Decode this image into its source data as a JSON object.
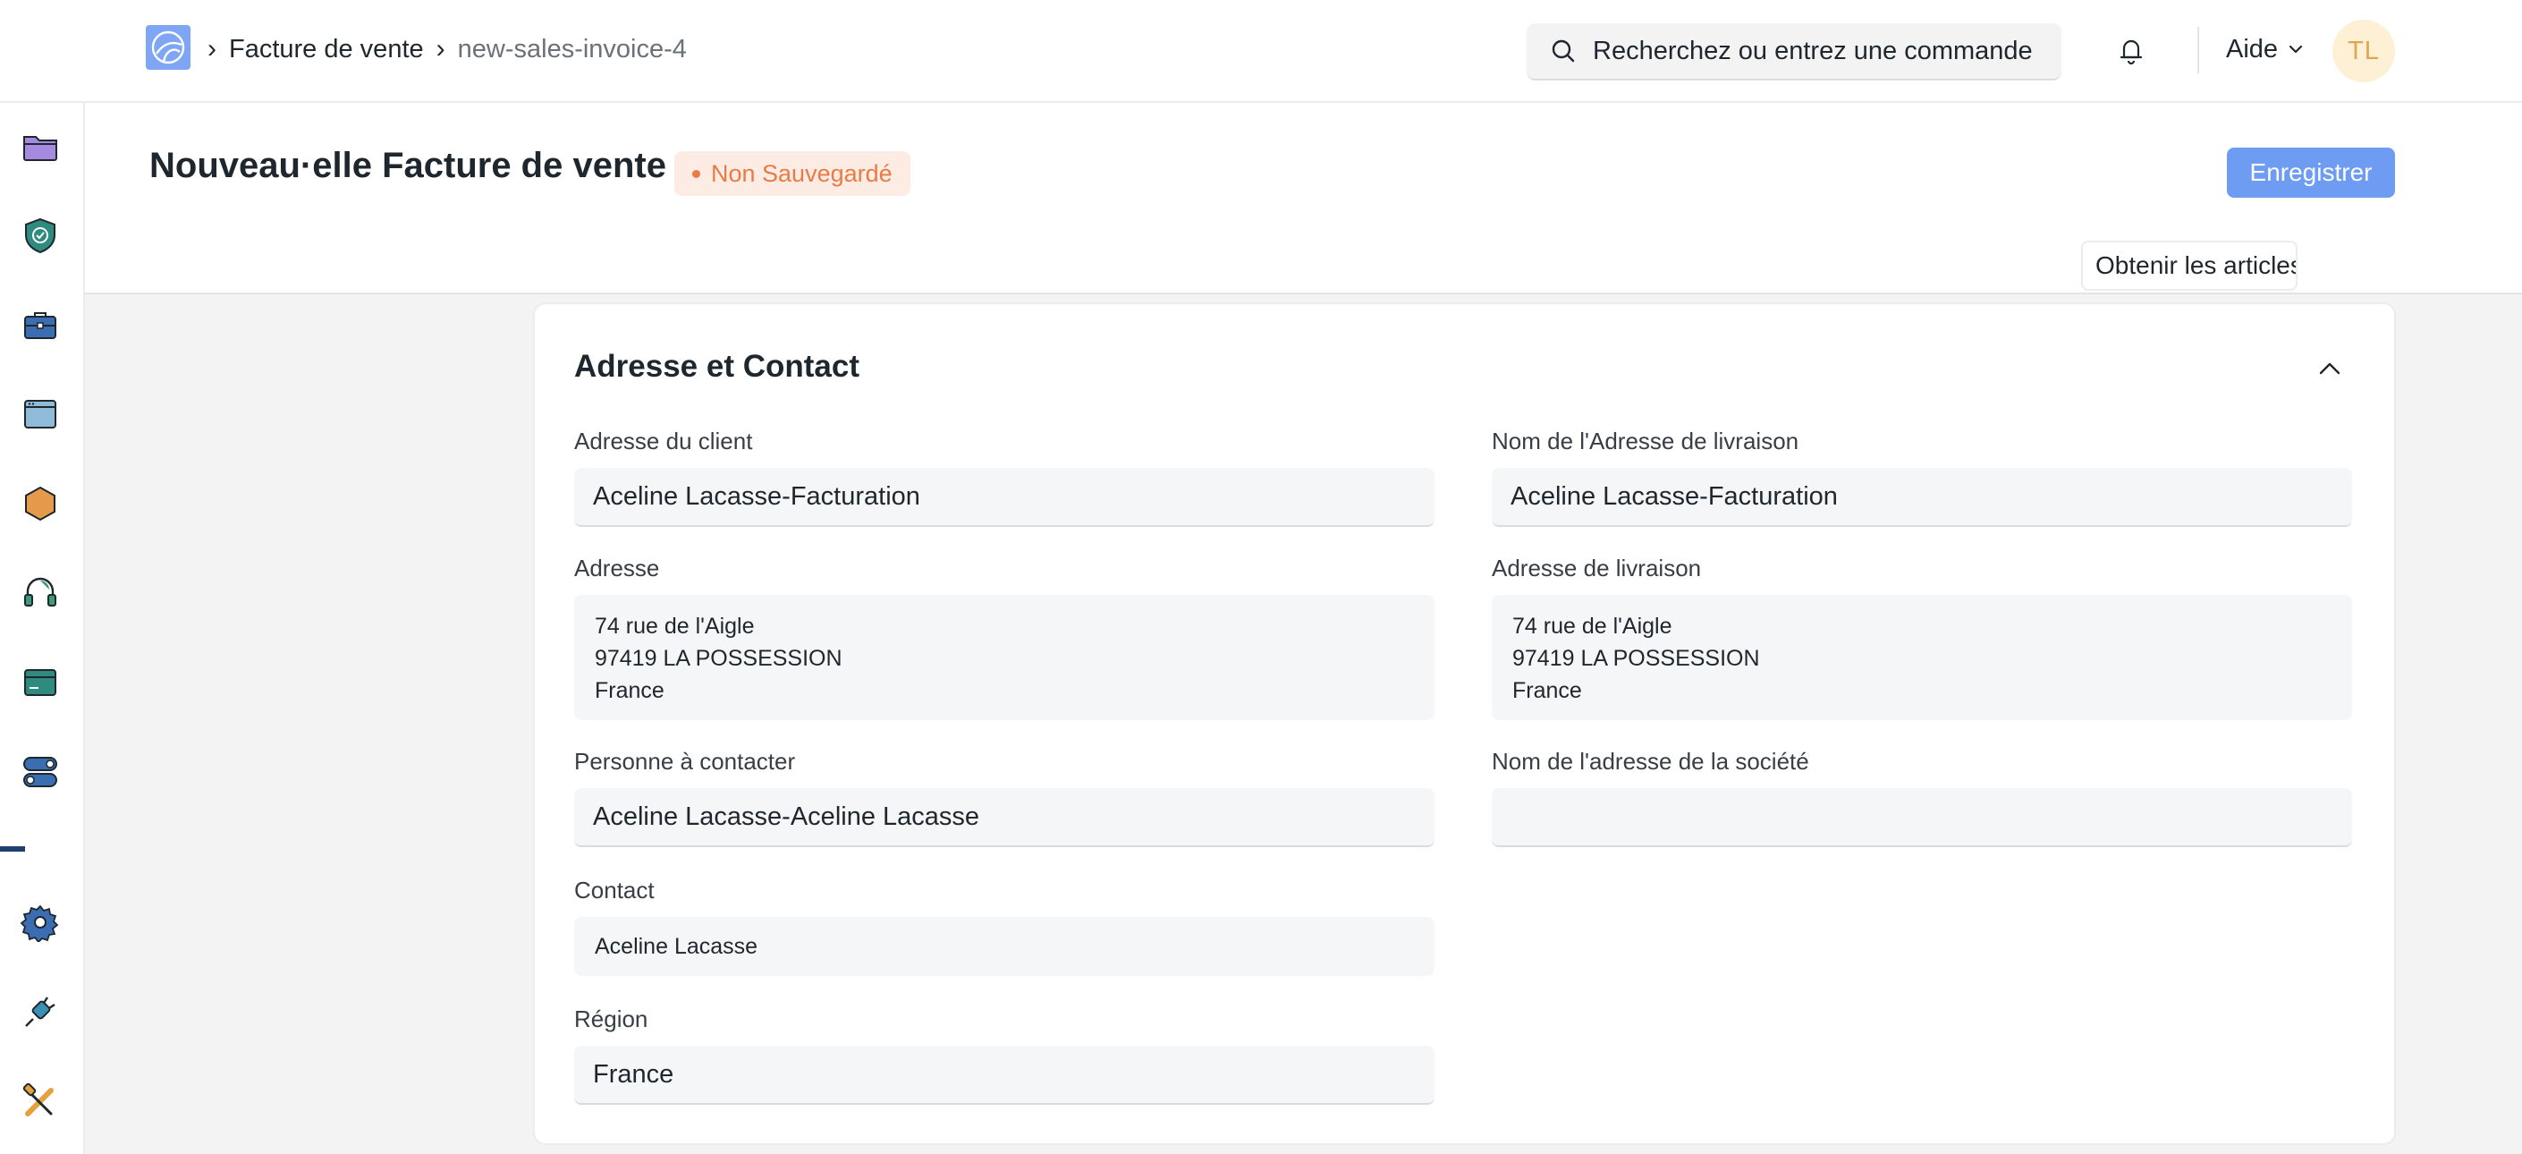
{
  "navbar": {
    "breadcrumb": [
      {
        "label": "Facture de vente"
      },
      {
        "label": "new-sales-invoice-4"
      }
    ],
    "search_placeholder": "Recherchez ou entrez une commande",
    "help_label": "Aide",
    "avatar_initials": "TL"
  },
  "sidebar": {
    "items": [
      {
        "icon": "folder-icon",
        "color": "#8b6bd1"
      },
      {
        "icon": "shield-check-icon",
        "color": "#2f8a80"
      },
      {
        "icon": "briefcase-icon",
        "color": "#3b6db3"
      },
      {
        "icon": "window-icon",
        "color": "#6aa0c9"
      },
      {
        "icon": "hexagon-icon",
        "color": "#e69a4c"
      },
      {
        "icon": "headset-icon",
        "color": "#3f9a78"
      },
      {
        "icon": "card-icon",
        "color": "#2f8a80"
      },
      {
        "icon": "toggles-icon",
        "color": "#3b6db3"
      },
      {
        "icon": "gear-icon",
        "color": "#3b6db3"
      },
      {
        "icon": "plug-icon",
        "color": "#3b8fb3"
      },
      {
        "icon": "tools-icon",
        "color": "#e6a13d"
      }
    ]
  },
  "page": {
    "title": "Nouveau·elle Facture de vente",
    "status": "Non Sauvegardé",
    "save_label": "Enregistrer",
    "get_items_label": "Obtenir les articles de"
  },
  "section": {
    "title": "Adresse et Contact",
    "customer_address": {
      "label": "Adresse du client",
      "value": "Aceline Lacasse-Facturation"
    },
    "shipping_address_name": {
      "label": "Nom de l'Adresse de livraison",
      "value": "Aceline Lacasse-Facturation"
    },
    "address": {
      "label": "Adresse",
      "lines": [
        "74 rue de l'Aigle",
        "97419 LA POSSESSION",
        "France"
      ]
    },
    "shipping_address": {
      "label": "Adresse de livraison",
      "lines": [
        "74 rue de l'Aigle",
        "97419 LA POSSESSION",
        "France"
      ]
    },
    "contact_person": {
      "label": "Personne à contacter",
      "value": "Aceline Lacasse-Aceline Lacasse"
    },
    "company_address_name": {
      "label": "Nom de l'adresse de la société",
      "value": ""
    },
    "contact": {
      "label": "Contact",
      "value": "Aceline Lacasse"
    },
    "region": {
      "label": "Région",
      "value": "France"
    }
  },
  "colors": {
    "primary_button": "#6d9cf2",
    "status_text": "#e97b45",
    "status_bg": "#fdece4",
    "avatar_bg": "#fdf0d5",
    "avatar_text": "#e0a550"
  }
}
